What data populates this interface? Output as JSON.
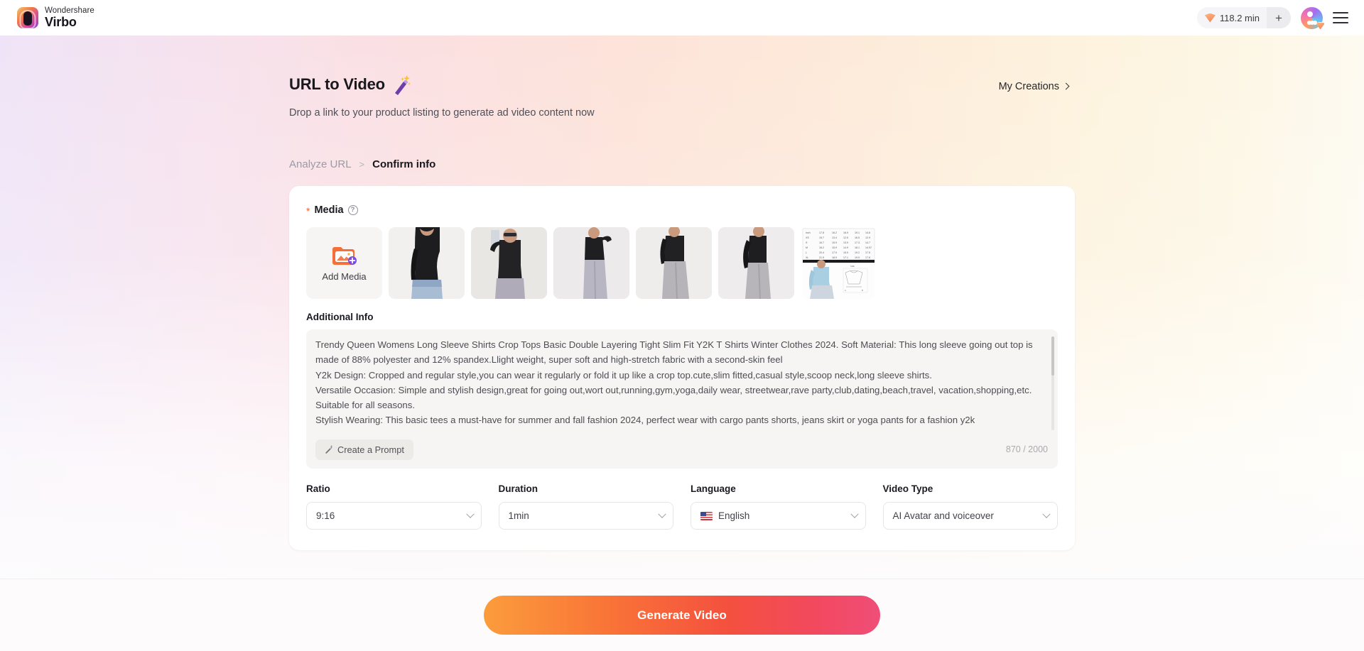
{
  "topbar": {
    "brand_sup": "Wondershare",
    "brand_main": "Virbo",
    "credits_value": "118.2 min",
    "credits_add_label": "+",
    "icons": {
      "gem": "gem-icon",
      "avatar": "avatar-icon",
      "menu": "hamburger-menu-icon"
    }
  },
  "header": {
    "title": "URL to Video",
    "title_icon": "magic-wand-icon",
    "subtitle": "Drop a link to your product listing to generate ad video content now",
    "my_creations": "My Creations"
  },
  "breadcrumb": {
    "step1": "Analyze URL",
    "separator": ">",
    "step2": "Confirm info"
  },
  "media": {
    "label": "Media",
    "required_mark": "*",
    "help_icon": "question-mark-icon",
    "add_label": "Add Media",
    "thumbnails": [
      {
        "alt": "woman in black long sleeve crop top with blue jeans"
      },
      {
        "alt": "woman with sunglasses holding phone in black top"
      },
      {
        "alt": "woman in black top and grey flared pants"
      },
      {
        "alt": "woman in black crop top and grey sweatpants"
      },
      {
        "alt": "woman side view in black top and grey pants"
      },
      {
        "alt": "size chart and light blue top measurement diagram"
      }
    ]
  },
  "additional_info": {
    "label": "Additional Info",
    "text": "Trendy Queen Womens Long Sleeve Shirts Crop Tops Basic Double Layering Tight Slim Fit Y2K T Shirts Winter Clothes 2024. Soft Material: This long sleeve going out top is made of 88% polyester and 12% spandex.Llight weight, super soft and high-stretch fabric with a second-skin feel\nY2k Design: Cropped and regular style,you can wear it regularly or fold it up like a crop top.cute,slim fitted,casual style,scoop neck,long sleeve shirts.\nVersatile Occasion: Simple and stylish design,great for going out,wort out,running,gym,yoga,daily wear, streetwear,rave party,club,dating,beach,travel, vacation,shopping,etc. Suitable for all seasons.\nStylish Wearing: This basic tees a must-have for summer and fall fashion 2024, perfect wear with cargo pants shorts, jeans skirt or yoga pants for a fashion y2k",
    "prompt_button": "Create a Prompt",
    "prompt_icon": "magic-pen-icon",
    "counter": "870 / 2000"
  },
  "fields": [
    {
      "label": "Ratio",
      "value": "9:16",
      "name": "ratio"
    },
    {
      "label": "Duration",
      "value": "1min",
      "name": "duration"
    },
    {
      "label": "Language",
      "value": "English",
      "name": "language",
      "flag": "us-flag-icon"
    },
    {
      "label": "Video Type",
      "value": "AI Avatar and voiceover",
      "name": "video-type"
    }
  ],
  "footer": {
    "generate_label": "Generate Video"
  },
  "colors": {
    "accent_orange": "#f97337",
    "accent_pink": "#f04e78",
    "required_red": "#f4643c",
    "text_dark": "#18181d",
    "text_muted": "#9b9ba3"
  }
}
